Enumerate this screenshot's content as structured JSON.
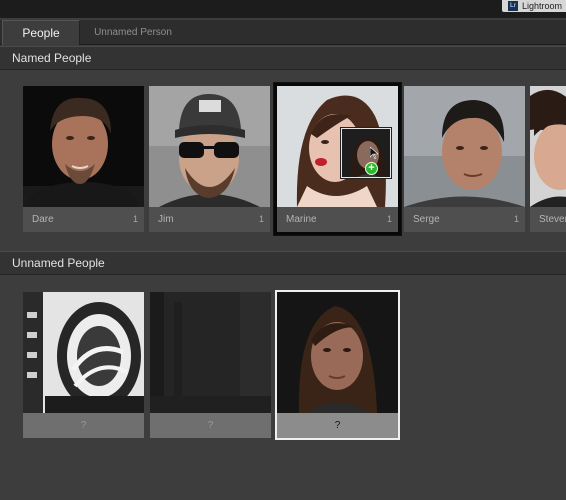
{
  "app": {
    "name": "Lightroom",
    "icon": "Lr"
  },
  "tabs": [
    {
      "label": "People",
      "active": true
    },
    {
      "label": "Unnamed Person",
      "active": false
    }
  ],
  "sections": {
    "named": {
      "title": "Named People"
    },
    "unnamed": {
      "title": "Unnamed People"
    }
  },
  "named_people": [
    {
      "name": "Dare",
      "count": "1"
    },
    {
      "name": "Jim",
      "count": "1"
    },
    {
      "name": "Marine",
      "count": "1",
      "selected": true
    },
    {
      "name": "Serge",
      "count": "1"
    },
    {
      "name": "Steven",
      "count": ""
    }
  ],
  "unnamed_people": [
    {
      "label": "?"
    },
    {
      "label": "?"
    },
    {
      "label": "?",
      "active": true
    }
  ],
  "drag_badge": {
    "symbol": "+",
    "color": "#2fb82f"
  },
  "colors": {
    "background": "#3d3d3d",
    "header": "#333333",
    "card": "#4f4f4f"
  }
}
